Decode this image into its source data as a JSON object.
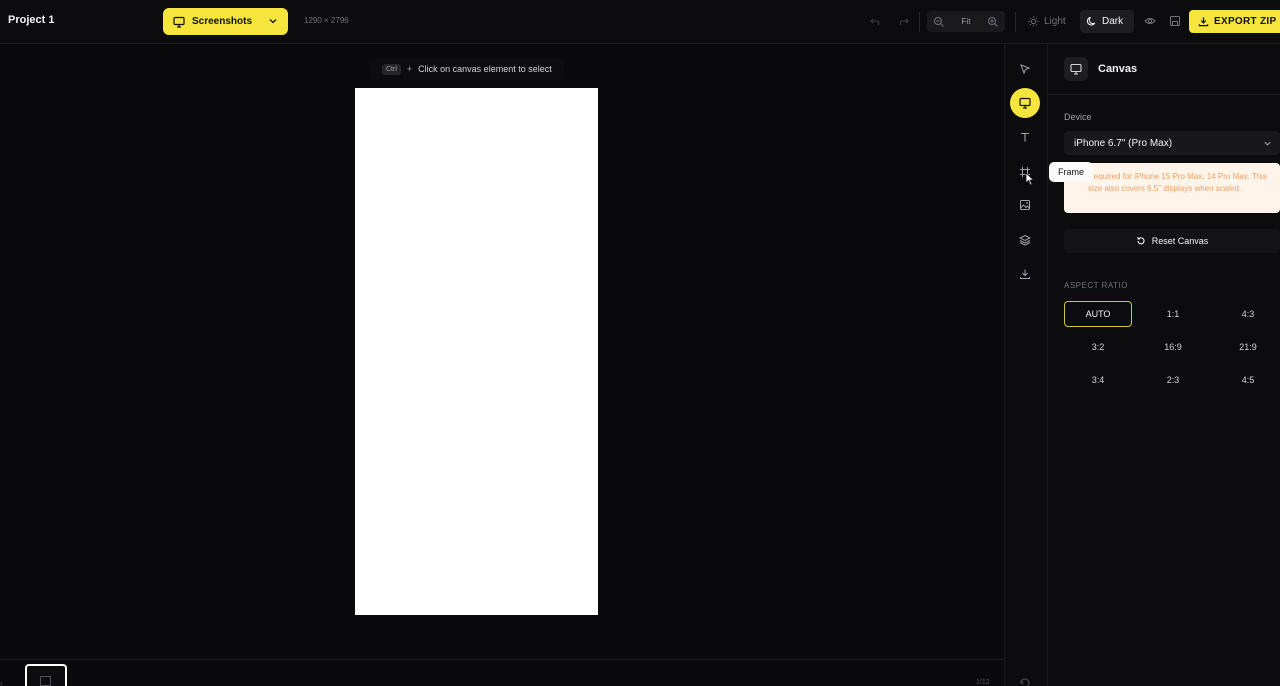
{
  "header": {
    "project_title": "Project 1",
    "mode_label": "Screenshots",
    "dimensions": "1290 × 2796",
    "zoom_fit_label": "Fit",
    "theme_light_label": "Light",
    "theme_dark_label": "Dark",
    "export_label": "EXPORT ZIP"
  },
  "canvas": {
    "hint_key": "Ctrl",
    "hint_plus": "+",
    "hint_text": "Click on canvas element to select",
    "page_count": "1/12"
  },
  "tooltip": {
    "text": "Frame"
  },
  "panel": {
    "title": "Canvas",
    "device_label": "Device",
    "device_value": "iPhone 6.7\" (Pro Max)",
    "note": "Required for iPhone 15 Pro Max, 14 Pro Max. This size also covers 6.5\" displays when scaled.",
    "reset_label": "Reset Canvas",
    "aspect_ratio_label": "ASPECT RATIO",
    "ratios": [
      "AUTO",
      "1:1",
      "4:3",
      "3:2",
      "16:9",
      "21:9",
      "3:4",
      "2:3",
      "4:5"
    ],
    "selected_ratio": "AUTO"
  },
  "colors": {
    "accent": "#f5e53d",
    "background": "#09090b",
    "note_text": "#f0a060"
  }
}
